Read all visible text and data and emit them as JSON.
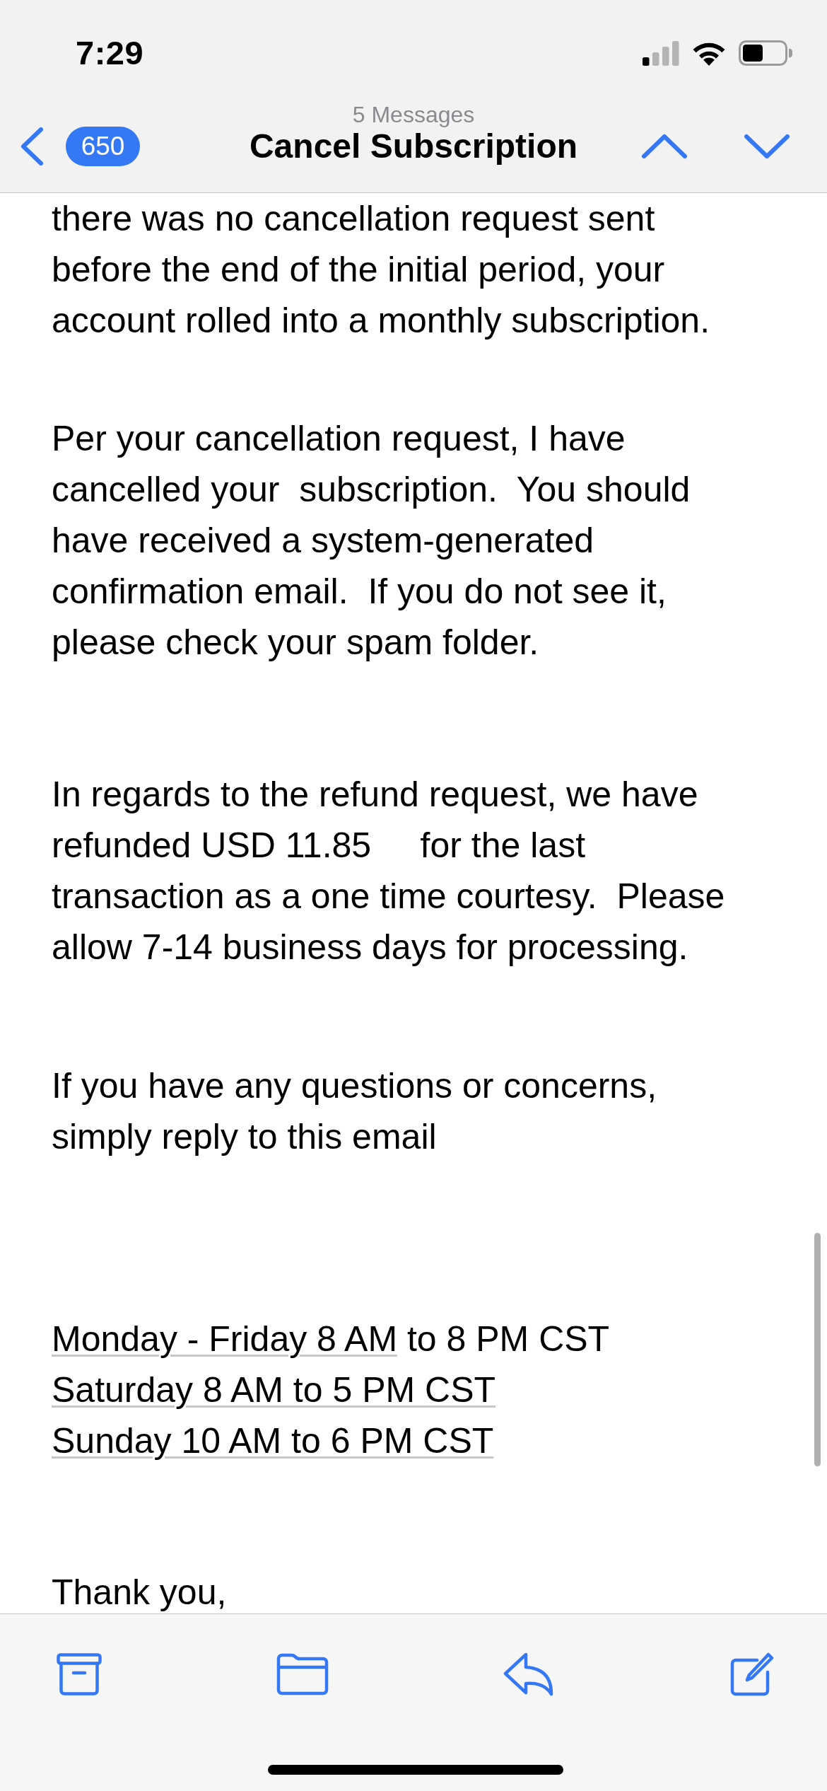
{
  "status_bar": {
    "time": "7:29"
  },
  "nav_bar": {
    "unread_count": "650",
    "subtitle": "5 Messages",
    "title": "Cancel Subscription"
  },
  "message": {
    "paragraphs": [
      {
        "lines": [
          "there was no cancellation request sent",
          "before the end of the initial period, your",
          "account rolled into a monthly subscription."
        ]
      },
      {
        "lines": [
          "Per your cancellation request, I have",
          "cancelled your  subscription.  You should",
          "have received a system-generated",
          "confirmation email.  If you do not see it,",
          "please check your spam folder."
        ]
      },
      {
        "lines": [
          "In regards to the refund request, we have",
          "refunded USD 11.85     for the last",
          "transaction as a one time courtesy.  Please",
          "allow 7-14 business days for processing."
        ]
      },
      {
        "lines": [
          "If you have any questions or concerns,",
          "simply reply to this email"
        ]
      }
    ],
    "business_hours": [
      {
        "segments": [
          {
            "text": "Monday - Friday 8 AM",
            "kind": "link"
          },
          {
            "text": " to 8 PM CST",
            "kind": "plain"
          }
        ]
      },
      {
        "segments": [
          {
            "text": "Saturday 8 AM to 5 PM CST",
            "kind": "link"
          }
        ]
      },
      {
        "segments": [
          {
            "text": "Sunday 10 AM to 6 PM CST",
            "kind": "link"
          }
        ]
      }
    ],
    "closing": "Thank you,"
  }
}
